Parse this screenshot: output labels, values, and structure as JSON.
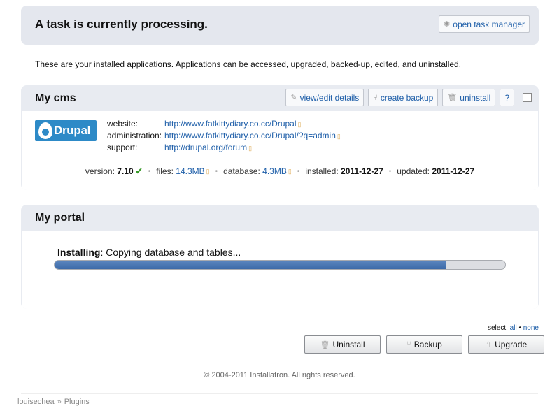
{
  "task_banner": {
    "title": "A task is currently processing.",
    "task_manager_label": "open task manager",
    "task_manager_icon": "gear-icon"
  },
  "intro": "These are your installed applications. Applications can be accessed, upgraded, backed-up, edited, and uninstalled.",
  "apps": {
    "cms": {
      "title": "My cms",
      "actions": {
        "view_edit": "view/edit details",
        "create_backup": "create backup",
        "uninstall": "uninstall",
        "help": "?"
      },
      "logo_text": "Drupal",
      "website_label": "website:",
      "website_url": "http://www.fatkittydiary.co.cc/Drupal",
      "admin_label": "administration:",
      "admin_url": "http://www.fatkittydiary.co.cc/Drupal/?q=admin",
      "support_label": "support:",
      "support_url": "http://drupal.org/forum",
      "meta": {
        "version_label": "version:",
        "version": "7.10",
        "files_label": "files:",
        "files": "14.3MB",
        "database_label": "database:",
        "database": "4.3MB",
        "installed_label": "installed:",
        "installed": "2011-12-27",
        "updated_label": "updated:",
        "updated": "2011-12-27"
      }
    },
    "portal": {
      "title": "My portal",
      "status_bold": "Installing",
      "status_rest": ": Copying database and tables...",
      "progress": 0.87
    }
  },
  "select": {
    "label": "select:",
    "all": "all",
    "dot": "•",
    "none": "none"
  },
  "bottom_actions": {
    "uninstall": "Uninstall",
    "backup": "Backup",
    "upgrade": "Upgrade"
  },
  "copyright": "© 2004-2011 Installatron. All rights reserved.",
  "breadcrumb": {
    "user": "louisechea",
    "sep": "»",
    "section": "Plugins"
  },
  "colors": {
    "panel_bg": "#e8ebf1",
    "link": "#1f5fa9",
    "progress": "#3c6aa8",
    "check": "#3a9a2a"
  }
}
